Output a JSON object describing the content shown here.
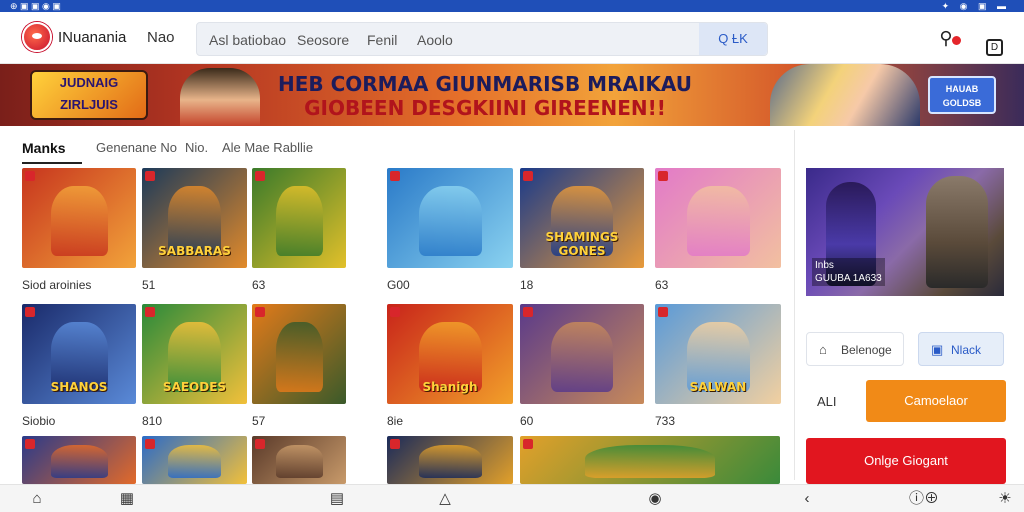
{
  "statusbar": {
    "left_text": "⊕ ▣ ▣ ◉ ▣",
    "right_text": "✦ ◉ ▣ ▬"
  },
  "header": {
    "brand": "INuanania",
    "nav_extra": "Nao",
    "search_tabs": [
      "Asl batiobao",
      "Seosore",
      "Fenil",
      "Aoolo"
    ],
    "search_button": "Q ȽK"
  },
  "banner": {
    "badge_left": [
      "JUDNAIG",
      "ZIRLJUIS"
    ],
    "title_line1": "HEB CORMAA GIUNMARISB MRAIKAU",
    "title_line2": "GIOBEEN DESGKIINI GIREENEN!!",
    "badge_right": "HAUAB GOLDSB"
  },
  "tabs": {
    "items": [
      "Manks",
      "Genenane No",
      "Nio.",
      "Ale Mae Rabllie"
    ]
  },
  "grid": {
    "rows": [
      [
        {
          "label": "Siod aroinies",
          "title": "",
          "colors": [
            "#c7351e",
            "#f2a33a"
          ]
        },
        {
          "label": "51",
          "title": "SABBARAS",
          "colors": [
            "#1c3a5a",
            "#e28a2a"
          ]
        },
        {
          "label": "63",
          "title": "",
          "colors": [
            "#3a7a2a",
            "#e2c02a"
          ]
        },
        {
          "label": "G00",
          "title": "",
          "colors": [
            "#2a7ac8",
            "#8ad2f0"
          ]
        },
        {
          "label": "18",
          "title": "SHAMINGS GONES",
          "colors": [
            "#1a3a8a",
            "#e89a3a"
          ]
        },
        {
          "label": "63",
          "title": "",
          "colors": [
            "#e27ac8",
            "#f2c0a0"
          ]
        }
      ],
      [
        {
          "label": "Siobio",
          "title": "SHANOS",
          "colors": [
            "#1a2a6a",
            "#5a8ad8"
          ]
        },
        {
          "label": "810",
          "title": "SAEODES",
          "colors": [
            "#2a8a3a",
            "#f2c03a"
          ]
        },
        {
          "label": "57",
          "title": "",
          "colors": [
            "#e27a1a",
            "#3a5a2a"
          ]
        },
        {
          "label": "8ie",
          "title": "Shanigh",
          "colors": [
            "#c8241a",
            "#f2a02a"
          ]
        },
        {
          "label": "60",
          "title": "",
          "colors": [
            "#5a3a8a",
            "#c88a5a"
          ]
        },
        {
          "label": "733",
          "title": "SALWAN",
          "colors": [
            "#5a9ad8",
            "#f2d0a0"
          ]
        }
      ],
      [
        {
          "label": "",
          "title": "",
          "colors": [
            "#2a3a8a",
            "#e26a2a"
          ]
        },
        {
          "label": "",
          "title": "",
          "colors": [
            "#2a6ac8",
            "#f2c03a"
          ]
        },
        {
          "label": "",
          "title": "",
          "colors": [
            "#5a3a2a",
            "#c89a6a"
          ]
        },
        {
          "label": "",
          "title": "",
          "colors": [
            "#1a2a5a",
            "#e2a02a"
          ]
        },
        {
          "label": "",
          "title": "",
          "colors": [
            "#e2a02a",
            "#3a8a3a"
          ]
        }
      ]
    ]
  },
  "side": {
    "caption": [
      "Inbs",
      "GUUBA 1A633"
    ],
    "btn_light": "Belenoge",
    "btn_blue": "Nlack",
    "small_text": "ALI",
    "orange_btn": "Camoelaor",
    "red_btn": "Onlge Giogant"
  },
  "bottomnav": {
    "icons": [
      "home-icon",
      "grid-icon",
      "list-icon",
      "user-icon",
      "game-icon",
      "back-icon",
      "info-icon",
      "settings-icon"
    ]
  }
}
